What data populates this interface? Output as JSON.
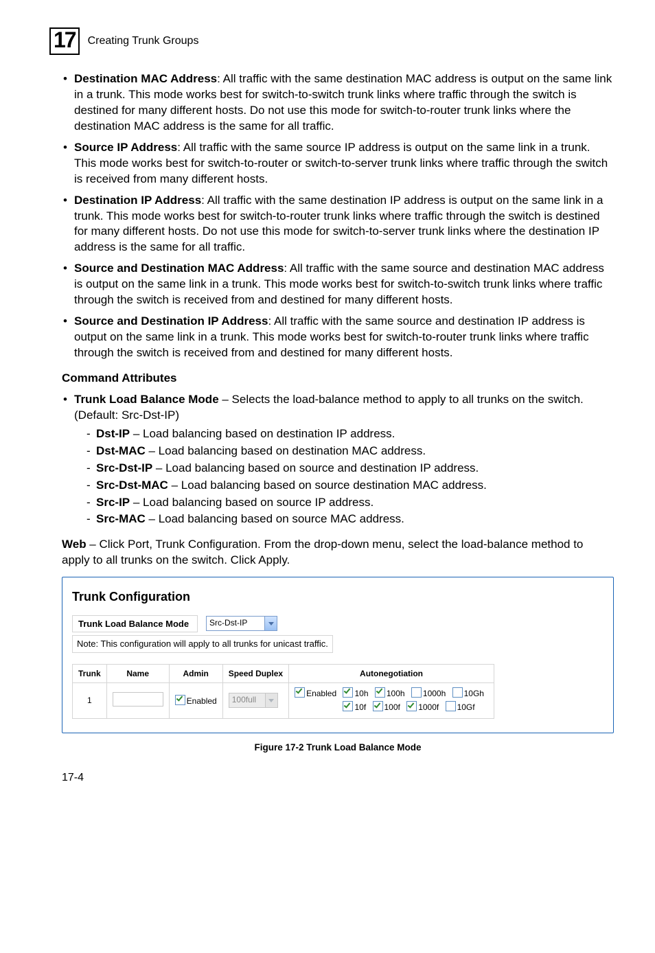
{
  "chapter": {
    "number": "17",
    "title": "Creating Trunk Groups"
  },
  "bullets_top": [
    {
      "term": "Destination MAC Address",
      "text": ": All traffic with the same destination MAC address is output on the same link in a trunk. This mode works best for switch-to-switch trunk links where traffic through the switch is destined for many different hosts. Do not use this mode for switch-to-router trunk links where the destination MAC address is the same for all traffic."
    },
    {
      "term": "Source IP Address",
      "text": ": All traffic with the same source IP address is output on the same link in a trunk. This mode works best for switch-to-router or switch-to-server trunk links where traffic through the switch is received from many different hosts."
    },
    {
      "term": "Destination IP Address",
      "text": ": All traffic with the same destination IP address is output on the same link in a trunk. This mode works best for switch-to-router trunk links where traffic through the switch is destined for many different hosts. Do not use this mode for switch-to-server trunk links where the destination IP address is the same for all traffic."
    },
    {
      "term": "Source and Destination MAC Address",
      "text": ": All traffic with the same source and destination MAC address is output on the same link in a trunk. This mode works best for switch-to-switch trunk links where traffic through the switch is received from and destined for many different hosts."
    },
    {
      "term": "Source and Destination IP Address",
      "text": ": All traffic with the same source and destination IP address is output on the same link in a trunk. This mode works best for switch-to-router trunk links where traffic through the switch is received from and destined for many different hosts."
    }
  ],
  "cmd_attr_heading": "Command Attributes",
  "cmd_attr": {
    "lead_term": "Trunk Load Balance Mode",
    "lead_text": " – Selects the load-balance method to apply to all trunks on the switch. (Default: Src-Dst-IP)",
    "items": [
      {
        "term": "Dst-IP",
        "text": "  – Load balancing based on destination IP address."
      },
      {
        "term": "Dst-MAC",
        "text": "  – Load balancing based on destination MAC address."
      },
      {
        "term": "Src-Dst-IP",
        "text": "  – Load balancing based on source and destination IP address."
      },
      {
        "term": "Src-Dst-MAC",
        "text": "  – Load balancing based on source destination MAC address."
      },
      {
        "term": "Src-IP",
        "text": "  – Load balancing based on source IP address."
      },
      {
        "term": "Src-MAC",
        "text": "  – Load balancing based on source MAC address."
      }
    ]
  },
  "web_para": {
    "lead": "Web",
    "text": " – Click Port, Trunk Configuration. From the drop-down menu, select the load-balance method to apply to all trunks on the switch. Click Apply."
  },
  "figure": {
    "panel_title": "Trunk Configuration",
    "mode_label": "Trunk Load Balance Mode",
    "mode_value": "Src-Dst-IP",
    "note": "Note: This configuration will apply to all trunks for unicast traffic.",
    "headers": {
      "trunk": "Trunk",
      "name": "Name",
      "admin": "Admin",
      "speed": "Speed Duplex",
      "auton": "Autonegotiation"
    },
    "row": {
      "trunk": "1",
      "admin_label": "Enabled",
      "speed_value": "100full",
      "auton_enabled": "Enabled",
      "auton_opts1": [
        "10h",
        "100h",
        "1000h",
        "10Gh"
      ],
      "auton_checks1": [
        true,
        true,
        false,
        false
      ],
      "auton_opts2": [
        "10f",
        "100f",
        "1000f",
        "10Gf"
      ],
      "auton_checks2": [
        true,
        true,
        true,
        false
      ]
    },
    "caption": "Figure 17-2  Trunk Load Balance Mode"
  },
  "pagenum": "17-4"
}
